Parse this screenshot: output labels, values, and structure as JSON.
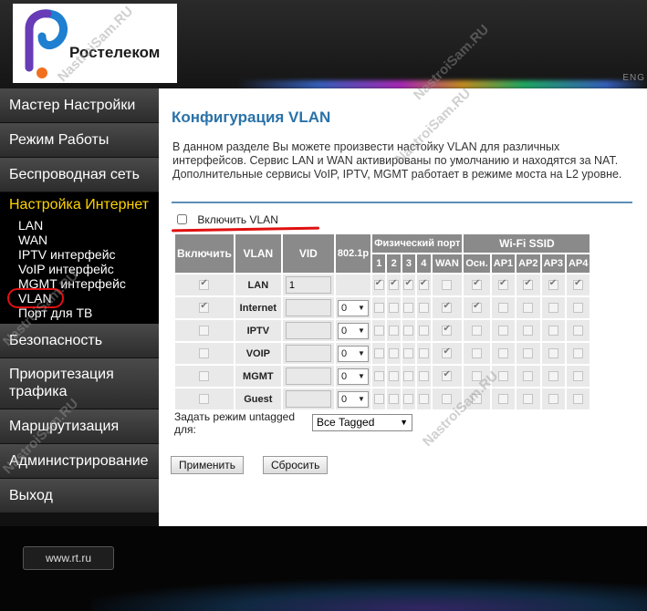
{
  "header": {
    "brand": "Ростелеком",
    "corner_label": "ENG"
  },
  "sidebar": {
    "items": [
      {
        "label": "Мастер Настройки"
      },
      {
        "label": "Режим Работы"
      },
      {
        "label": "Беспроводная сеть"
      },
      {
        "label": "Настройка Интернет"
      },
      {
        "label": "Безопасность"
      },
      {
        "label": "Приоритезация трафика"
      },
      {
        "label": "Маршрутизация"
      },
      {
        "label": "Администрирование"
      },
      {
        "label": "Выход"
      }
    ],
    "subitems": [
      "LAN",
      "WAN",
      "IPTV интерфейс",
      "VoIP интерфейс",
      "MGMT интерфейс",
      "VLAN",
      "Порт для ТВ"
    ]
  },
  "main": {
    "title": "Конфигурация VLAN",
    "description": "В данном разделе Вы можете произвести настойку VLAN для различных интерфейсов. Сервис LAN и WAN активированы по умолчанию и находятся за NAT. Дополнительные сервисы VoIP, IPTV, MGMT работает в режиме моста на L2 уровне.",
    "enable_label": "Включить VLAN",
    "table": {
      "headers": {
        "enable": "Включить",
        "vlan": "VLAN",
        "vid": "VID",
        "prio": "802.1p",
        "phys": "Физический порт",
        "wifi": "Wi-Fi SSID"
      },
      "phys_ports": [
        "1",
        "2",
        "3",
        "4",
        "WAN"
      ],
      "wifi_ports": [
        "Осн.",
        "AP1",
        "AP2",
        "AP3",
        "AP4"
      ],
      "rows": [
        {
          "name": "LAN",
          "vid": "1",
          "prio": "",
          "enable": true,
          "phys": [
            true,
            true,
            true,
            true,
            false
          ],
          "wifi": [
            true,
            true,
            true,
            true,
            true
          ]
        },
        {
          "name": "Internet",
          "vid": "",
          "prio": "0",
          "enable": true,
          "phys": [
            false,
            false,
            false,
            false,
            true
          ],
          "wifi": [
            true,
            false,
            false,
            false,
            false
          ]
        },
        {
          "name": "IPTV",
          "vid": "",
          "prio": "0",
          "enable": false,
          "phys": [
            false,
            false,
            false,
            false,
            true
          ],
          "wifi": [
            false,
            false,
            false,
            false,
            false
          ]
        },
        {
          "name": "VOIP",
          "vid": "",
          "prio": "0",
          "enable": false,
          "phys": [
            false,
            false,
            false,
            false,
            true
          ],
          "wifi": [
            false,
            false,
            false,
            false,
            false
          ]
        },
        {
          "name": "MGMT",
          "vid": "",
          "prio": "0",
          "enable": false,
          "phys": [
            false,
            false,
            false,
            false,
            true
          ],
          "wifi": [
            false,
            false,
            false,
            false,
            false
          ]
        },
        {
          "name": "Guest",
          "vid": "",
          "prio": "0",
          "enable": false,
          "phys": [
            false,
            false,
            false,
            false,
            false
          ],
          "wifi": [
            false,
            false,
            false,
            false,
            false
          ]
        }
      ]
    },
    "untagged_label": "Задать режим untagged для:",
    "untagged_value": "Все Tagged",
    "apply_label": "Применить",
    "reset_label": "Сбросить"
  },
  "footer": {
    "link": "www.rt.ru"
  },
  "watermarks": [
    "NastroiSam.RU",
    "NastroiSam.RU",
    "NastroiSam.RU",
    "NastroiSam.RU",
    "NastroiSam.RU",
    "NastroiSam.RU"
  ],
  "colors": {
    "accent_title": "#2a72a8",
    "active_menu": "#ffd400",
    "highlight_red": "#e01010",
    "table_header": "#8a8a8a"
  }
}
